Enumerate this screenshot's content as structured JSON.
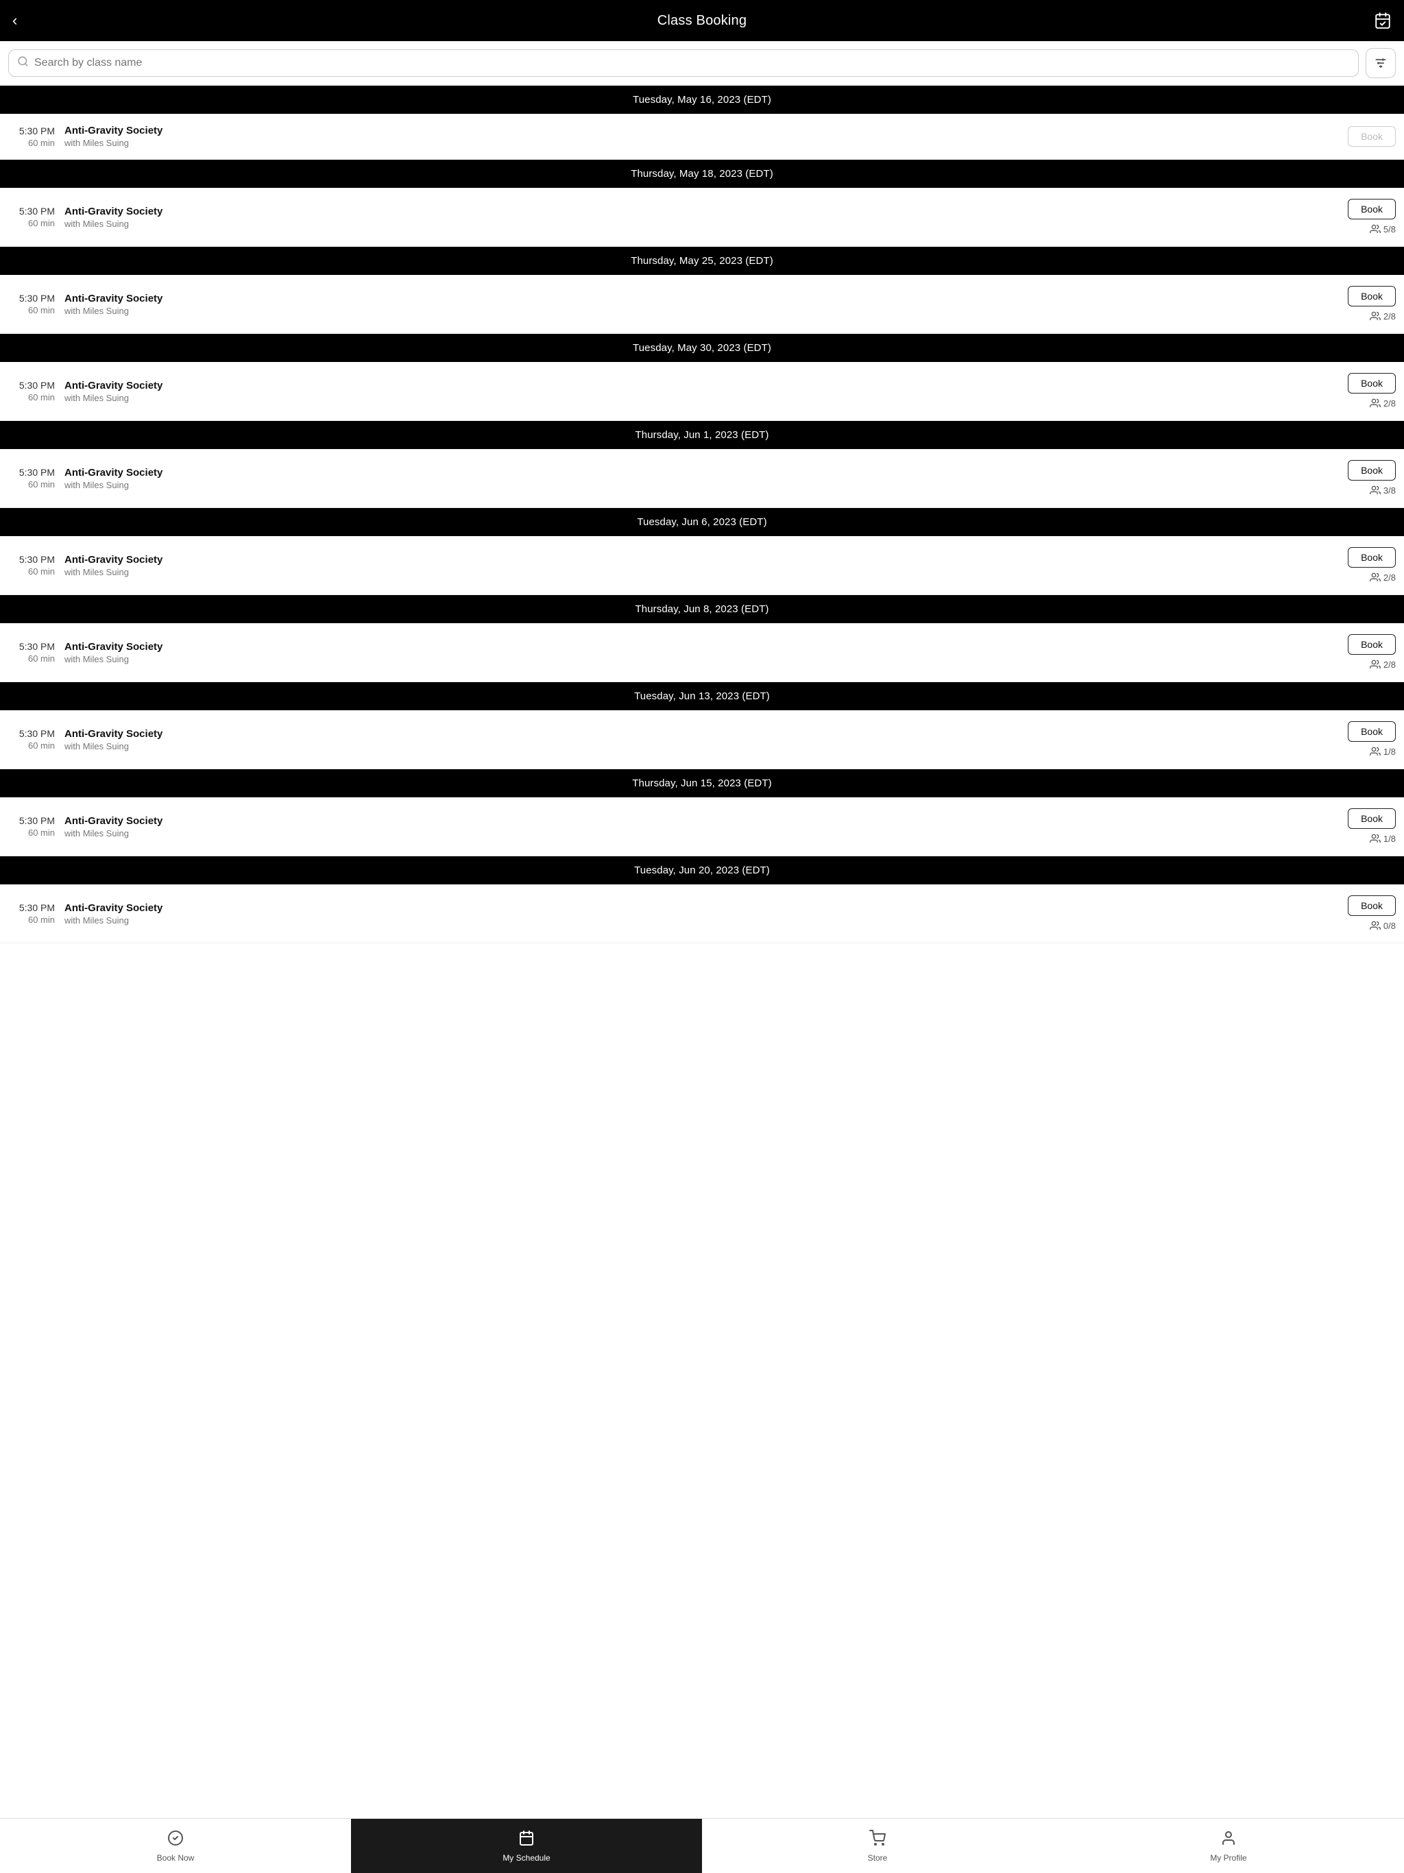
{
  "header": {
    "title": "Class Booking",
    "back_icon": "‹",
    "calendar_icon": "📅"
  },
  "search": {
    "placeholder": "Search by class name"
  },
  "classes": [
    {
      "date": "Tuesday, May 16, 2023 (EDT)",
      "time": "5:30 PM",
      "duration": "60 min",
      "name": "Anti-Gravity Society",
      "instructor": "with Miles Suing",
      "book_label": "Book",
      "book_disabled": true,
      "capacity": null
    },
    {
      "date": "Thursday, May 18, 2023 (EDT)",
      "time": "5:30 PM",
      "duration": "60 min",
      "name": "Anti-Gravity Society",
      "instructor": "with Miles Suing",
      "book_label": "Book",
      "book_disabled": false,
      "capacity": "5/8"
    },
    {
      "date": "Thursday, May 25, 2023 (EDT)",
      "time": "5:30 PM",
      "duration": "60 min",
      "name": "Anti-Gravity Society",
      "instructor": "with Miles Suing",
      "book_label": "Book",
      "book_disabled": false,
      "capacity": "2/8"
    },
    {
      "date": "Tuesday, May 30, 2023 (EDT)",
      "time": "5:30 PM",
      "duration": "60 min",
      "name": "Anti-Gravity Society",
      "instructor": "with Miles Suing",
      "book_label": "Book",
      "book_disabled": false,
      "capacity": "2/8"
    },
    {
      "date": "Thursday, Jun 1, 2023 (EDT)",
      "time": "5:30 PM",
      "duration": "60 min",
      "name": "Anti-Gravity Society",
      "instructor": "with Miles Suing",
      "book_label": "Book",
      "book_disabled": false,
      "capacity": "3/8"
    },
    {
      "date": "Tuesday, Jun 6, 2023 (EDT)",
      "time": "5:30 PM",
      "duration": "60 min",
      "name": "Anti-Gravity Society",
      "instructor": "with Miles Suing",
      "book_label": "Book",
      "book_disabled": false,
      "capacity": "2/8"
    },
    {
      "date": "Thursday, Jun 8, 2023 (EDT)",
      "time": "5:30 PM",
      "duration": "60 min",
      "name": "Anti-Gravity Society",
      "instructor": "with Miles Suing",
      "book_label": "Book",
      "book_disabled": false,
      "capacity": "2/8"
    },
    {
      "date": "Tuesday, Jun 13, 2023 (EDT)",
      "time": "5:30 PM",
      "duration": "60 min",
      "name": "Anti-Gravity Society",
      "instructor": "with Miles Suing",
      "book_label": "Book",
      "book_disabled": false,
      "capacity": "1/8"
    },
    {
      "date": "Thursday, Jun 15, 2023 (EDT)",
      "time": "5:30 PM",
      "duration": "60 min",
      "name": "Anti-Gravity Society",
      "instructor": "with Miles Suing",
      "book_label": "Book",
      "book_disabled": false,
      "capacity": "1/8"
    },
    {
      "date": "Tuesday, Jun 20, 2023 (EDT)",
      "time": "5:30 PM",
      "duration": "60 min",
      "name": "Anti-Gravity Society",
      "instructor": "with Miles Suing",
      "book_label": "Book",
      "book_disabled": false,
      "capacity": "0/8"
    }
  ],
  "nav": {
    "items": [
      {
        "id": "book-now",
        "label": "Book Now",
        "icon": "✓",
        "active": false
      },
      {
        "id": "my-schedule",
        "label": "My Schedule",
        "icon": "📅",
        "active": true
      },
      {
        "id": "store",
        "label": "Store",
        "icon": "🛒",
        "active": false
      },
      {
        "id": "my-profile",
        "label": "My Profile",
        "icon": "👤",
        "active": false
      }
    ]
  }
}
